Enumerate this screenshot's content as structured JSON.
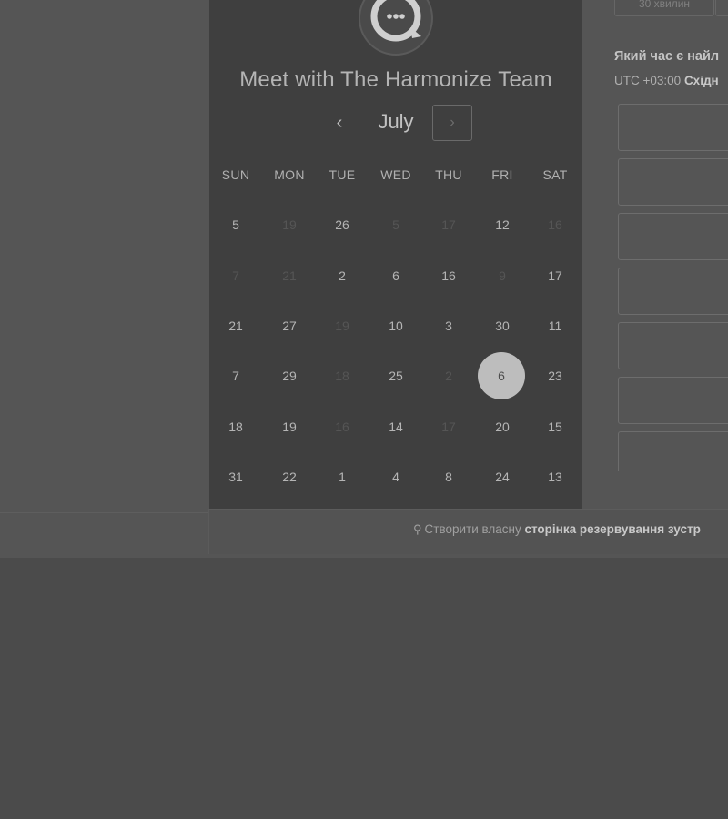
{
  "scheduler": {
    "title": "Meet with The Harmonize Team",
    "month": "July",
    "prev_label": "‹",
    "next_label": "›",
    "weekdays": [
      "SUN",
      "MON",
      "TUE",
      "WED",
      "THU",
      "FRI",
      "SAT"
    ],
    "days": [
      [
        "5",
        "19",
        "26",
        "5",
        "17",
        "12",
        "16"
      ],
      [
        "7",
        "21",
        "2",
        "6",
        "16",
        "9",
        "17"
      ],
      [
        "21",
        "27",
        "19",
        "10",
        "3",
        "30",
        "11"
      ],
      [
        "7",
        "29",
        "18",
        "25",
        "2",
        "6",
        "23"
      ],
      [
        "18",
        "19",
        "16",
        "14",
        "17",
        "20",
        "15"
      ],
      [
        "31",
        "22",
        "1",
        "4",
        "8",
        "24",
        "13"
      ]
    ],
    "selected_day": "6"
  },
  "duration": {
    "selected_label": "30 хвилин"
  },
  "time_picker": {
    "question": "Який час є найл",
    "timezone_prefix": "UTC +03:00",
    "timezone_name": "Східн"
  },
  "footer": {
    "icon": "hubspot-sprocket-icon",
    "text_prefix": "Створити власну",
    "text_bold": "сторінка резервування зустр"
  },
  "colors": {
    "overlay_background": "#4b4b4b",
    "calendar_panel": "#3f3f3f",
    "selected_day": "#bdbdbd"
  }
}
